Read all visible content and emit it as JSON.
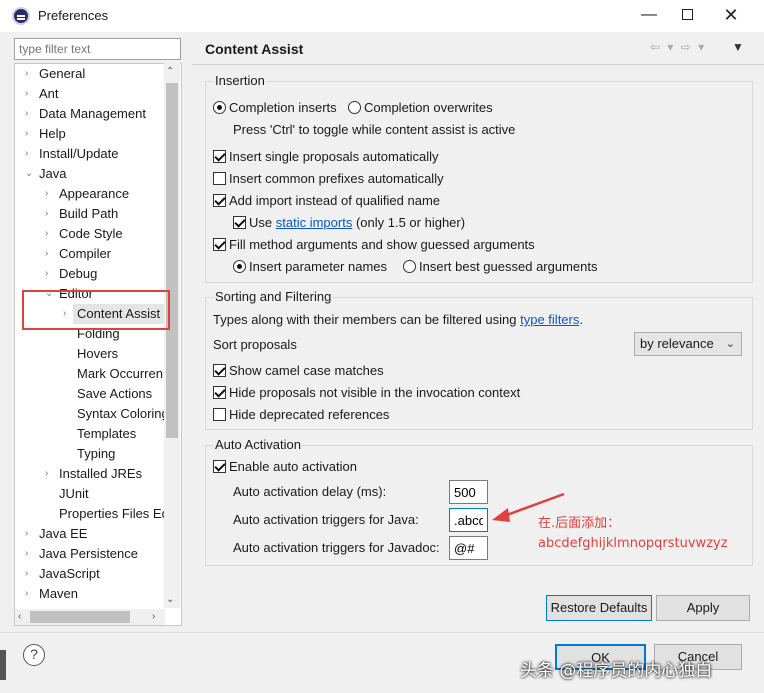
{
  "window": {
    "title": "Preferences",
    "minimize": "—",
    "close": "✕"
  },
  "filter": {
    "placeholder": "type filter text"
  },
  "tree": {
    "items": [
      {
        "label": "General",
        "level": 0,
        "chevron": "›"
      },
      {
        "label": "Ant",
        "level": 0,
        "chevron": "›"
      },
      {
        "label": "Data Management",
        "level": 0,
        "chevron": "›"
      },
      {
        "label": "Help",
        "level": 0,
        "chevron": "›"
      },
      {
        "label": "Install/Update",
        "level": 0,
        "chevron": "›"
      },
      {
        "label": "Java",
        "level": 0,
        "chevron": "⌄"
      },
      {
        "label": "Appearance",
        "level": 1,
        "chevron": "›"
      },
      {
        "label": "Build Path",
        "level": 1,
        "chevron": "›"
      },
      {
        "label": "Code Style",
        "level": 1,
        "chevron": "›"
      },
      {
        "label": "Compiler",
        "level": 1,
        "chevron": "›"
      },
      {
        "label": "Debug",
        "level": 1,
        "chevron": "›"
      },
      {
        "label": "Editor",
        "level": 1,
        "chevron": "⌄"
      },
      {
        "label": "Content Assist",
        "level": 2,
        "chevron": "›",
        "selected": true
      },
      {
        "label": "Folding",
        "level": 2,
        "chevron": ""
      },
      {
        "label": "Hovers",
        "level": 2,
        "chevron": ""
      },
      {
        "label": "Mark Occurren",
        "level": 2,
        "chevron": ""
      },
      {
        "label": "Save Actions",
        "level": 2,
        "chevron": ""
      },
      {
        "label": "Syntax Coloring",
        "level": 2,
        "chevron": ""
      },
      {
        "label": "Templates",
        "level": 2,
        "chevron": ""
      },
      {
        "label": "Typing",
        "level": 2,
        "chevron": ""
      },
      {
        "label": "Installed JREs",
        "level": 1,
        "chevron": "›"
      },
      {
        "label": "JUnit",
        "level": 1,
        "chevron": ""
      },
      {
        "label": "Properties Files Ed",
        "level": 1,
        "chevron": ""
      },
      {
        "label": "Java EE",
        "level": 0,
        "chevron": "›"
      },
      {
        "label": "Java Persistence",
        "level": 0,
        "chevron": "›"
      },
      {
        "label": "JavaScript",
        "level": 0,
        "chevron": "›"
      },
      {
        "label": "Maven",
        "level": 0,
        "chevron": "›"
      }
    ]
  },
  "page": {
    "title": "Content Assist",
    "nav": "⇦ ▾ ⇨ ▾",
    "menu": "▼"
  },
  "insertion": {
    "label": "Insertion",
    "completion_inserts": "Completion inserts",
    "completion_overwrites": "Completion overwrites",
    "ctrl_hint": "Press 'Ctrl' to toggle while content assist is active",
    "insert_single": "Insert single proposals automatically",
    "insert_common": "Insert common prefixes automatically",
    "add_import": "Add import instead of qualified name",
    "use": "Use",
    "static_imports": "static imports",
    "only_15": "(only 1.5 or higher)",
    "fill_method": "Fill method arguments and show guessed arguments",
    "insert_param": "Insert parameter names",
    "insert_best": "Insert best guessed arguments"
  },
  "sorting": {
    "label": "Sorting and Filtering",
    "types_text": "Types along with their members can be filtered using",
    "type_filters": "type filters",
    "period": ".",
    "sort_proposals": "Sort proposals",
    "sort_value": "by relevance",
    "sort_arrow": "⌄",
    "camel": "Show camel case matches",
    "hide_not_visible": "Hide proposals not visible in the invocation context",
    "hide_deprecated": "Hide deprecated references"
  },
  "auto": {
    "label": "Auto Activation",
    "enable": "Enable auto activation",
    "delay_label": "Auto activation delay (ms):",
    "delay_value": "500",
    "java_label": "Auto activation triggers for Java:",
    "java_value": ".abcd",
    "javadoc_label": "Auto activation triggers for Javadoc:",
    "javadoc_value": "@#"
  },
  "annotation": {
    "line1": "在.后面添加：",
    "line2": "abcdefghijklmnopqrstuvwzyz"
  },
  "buttons": {
    "restore": "Restore Defaults",
    "apply": "Apply",
    "ok": "OK",
    "cancel": "Cancel"
  },
  "help": "?",
  "watermark": "头条 @程序员的内心独白",
  "colors": {
    "accent": "#0078d7",
    "annotation_red": "#e0413e",
    "link": "#0b57c8"
  }
}
